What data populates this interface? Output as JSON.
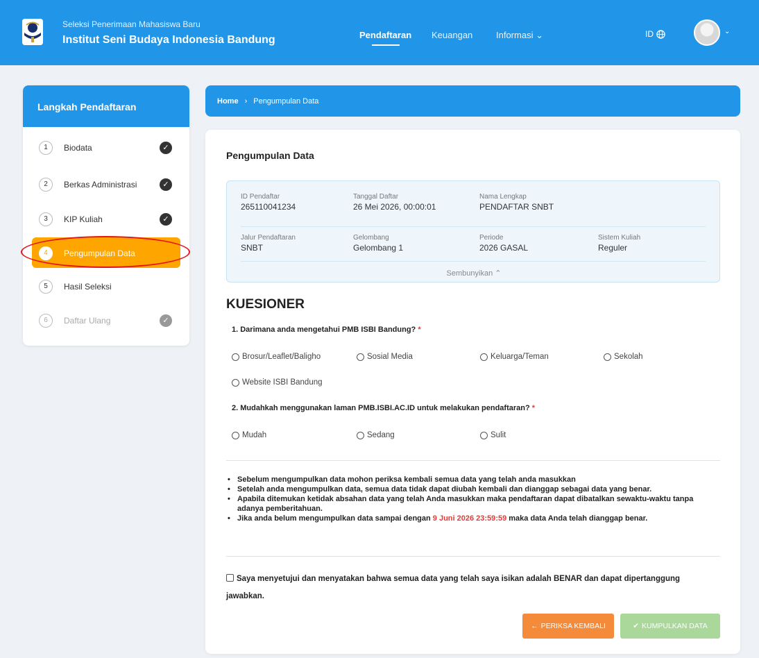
{
  "header": {
    "subtitle": "Seleksi Penerimaan Mahasiswa Baru",
    "title": "Institut Seni Budaya Indonesia Bandung",
    "nav": [
      {
        "label": "Pendaftaran"
      },
      {
        "label": "Keuangan"
      },
      {
        "label": "Informasi ⌄"
      }
    ],
    "lang": "ID"
  },
  "sidebar": {
    "title": "Langkah Pendaftaran",
    "steps": [
      {
        "num": "1",
        "label": "Biodata",
        "done": true
      },
      {
        "num": "2",
        "label": "Berkas Administrasi",
        "done": true
      },
      {
        "num": "3",
        "label": "KIP Kuliah",
        "done": true
      },
      {
        "num": "4",
        "label": "Pengumpulan Data",
        "active": true
      },
      {
        "num": "5",
        "label": "Hasil Seleksi"
      },
      {
        "num": "6",
        "label": "Daftar Ulang",
        "done": true,
        "muted": true
      }
    ]
  },
  "breadcrumb": {
    "home": "Home",
    "sep": "›",
    "current": "Pengumpulan Data"
  },
  "panel": {
    "title": "Pengumpulan Data",
    "info": {
      "id_label": "ID Pendaftar",
      "id_value": "265110041234",
      "tgl_label": "Tanggal Daftar",
      "tgl_value": "26 Mei 2026, 00:00:01",
      "nama_label": "Nama Lengkap",
      "nama_value": "PENDAFTAR SNBT",
      "jalur_label": "Jalur Pendaftaran",
      "jalur_value": "SNBT",
      "gel_label": "Gelombang",
      "gel_value": "Gelombang 1",
      "periode_label": "Periode",
      "periode_value": "2026 GASAL",
      "sistem_label": "Sistem Kuliah",
      "sistem_value": "Reguler",
      "hide_label": "Sembunyikan ⌃"
    },
    "kuesioner": {
      "title": "KUESIONER",
      "q1": "1. Darimana anda mengetahui PMB ISBI Bandung?",
      "q1_options": [
        "Brosur/Leaflet/Baligho",
        "Sosial Media",
        "Keluarga/Teman",
        "Sekolah",
        "Website ISBI Bandung"
      ],
      "q2": "2. Mudahkah menggunakan laman PMB.ISBI.AC.ID untuk melakukan pendaftaran?",
      "q2_options": [
        "Mudah",
        "Sedang",
        "Sulit"
      ],
      "required_mark": "*"
    },
    "notes": {
      "n1": "Sebelum mengumpulkan data mohon periksa kembali semua data yang telah anda masukkan",
      "n2": "Setelah anda mengumpulkan data, semua data tidak dapat diubah kembali dan dianggap sebagai data yang benar.",
      "n3": "Apabila ditemukan ketidak absahan data yang telah Anda masukkan maka pendaftaran dapat dibatalkan sewaktu-waktu tanpa adanya pemberitahuan.",
      "n4_before": "Jika anda belum mengumpulkan data sampai dengan ",
      "n4_date": "9 Juni 2026 23:59:59",
      "n4_after": " maka data Anda telah dianggap benar."
    },
    "agree_text": "Saya menyetujui dan menyatakan bahwa semua data yang telah saya isikan adalah BENAR dan dapat dipertanggung jawabkan.",
    "btn_back": "PERIKSA KEMBALI",
    "btn_submit": "KUMPULKAN DATA"
  },
  "colors": {
    "primary": "#2196e8",
    "active_step": "#ffa500",
    "back_button": "#f48b3b",
    "submit_button": "#a9d89a",
    "highlight": "#e5141b"
  }
}
